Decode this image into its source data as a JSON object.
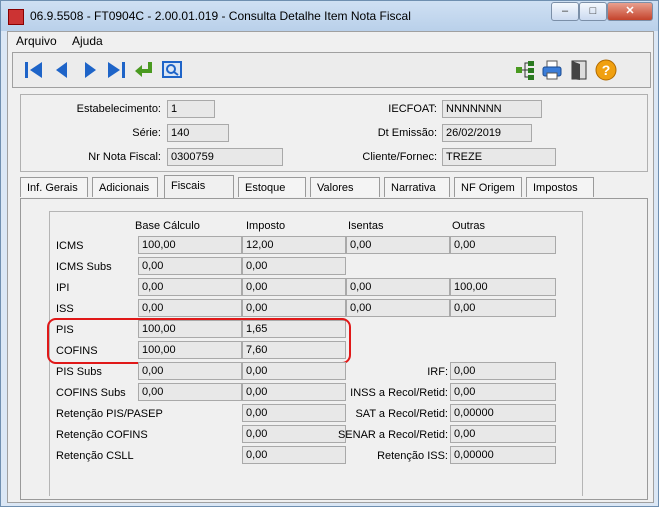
{
  "window": {
    "title": "06.9.5508 - FT0904C - 2.00.01.019 - Consulta Detalhe Item Nota Fiscal"
  },
  "menu": {
    "items": [
      "Arquivo",
      "Ajuda"
    ]
  },
  "header": {
    "estabelecimento": {
      "label": "Estabelecimento:",
      "value": "1"
    },
    "serie": {
      "label": "Série:",
      "value": "140"
    },
    "nr_nota": {
      "label": "Nr Nota Fiscal:",
      "value": "0300759"
    },
    "iecfoat": {
      "label": "IECFOAT:",
      "value": "NNNNNNN"
    },
    "dt_emissao": {
      "label": "Dt Emissão:",
      "value": "26/02/2019"
    },
    "cliente": {
      "label": "Cliente/Fornec:",
      "value": "TREZE"
    }
  },
  "tabs": [
    "Inf. Gerais",
    "Adicionais",
    "Fiscais",
    "Estoque",
    "Valores",
    "Narrativa",
    "NF Origem",
    "Impostos"
  ],
  "active_tab": "Fiscais",
  "fiscais": {
    "columns": [
      "Base Cálculo",
      "Imposto",
      "Isentas",
      "Outras"
    ],
    "rows": [
      {
        "label": "ICMS",
        "values": [
          "100,00",
          "12,00",
          "0,00",
          "0,00"
        ]
      },
      {
        "label": "ICMS Subs",
        "values": [
          "0,00",
          "0,00"
        ]
      },
      {
        "label": "IPI",
        "values": [
          "0,00",
          "0,00",
          "0,00",
          "100,00"
        ]
      },
      {
        "label": "ISS",
        "values": [
          "0,00",
          "0,00",
          "0,00",
          "0,00"
        ]
      },
      {
        "label": "PIS",
        "values": [
          "100,00",
          "1,65"
        ]
      },
      {
        "label": "COFINS",
        "values": [
          "100,00",
          "7,60"
        ]
      },
      {
        "label": "PIS Subs",
        "values": [
          "0,00",
          "0,00"
        ]
      },
      {
        "label": "COFINS Subs",
        "values": [
          "0,00",
          "0,00"
        ]
      },
      {
        "label": "Retenção PIS/PASEP",
        "values": [
          "0,00"
        ]
      },
      {
        "label": "Retenção COFINS",
        "values": [
          "0,00"
        ]
      },
      {
        "label": "Retenção CSLL",
        "values": [
          "0,00"
        ]
      }
    ],
    "right": [
      {
        "label": "IRF:",
        "value": "0,00"
      },
      {
        "label": "INSS a Recol/Retid:",
        "value": "0,00"
      },
      {
        "label": "SAT a Recol/Retid:",
        "value": "0,00000"
      },
      {
        "label": "SENAR a Recol/Retid:",
        "value": "0,00"
      },
      {
        "label": "Retenção ISS:",
        "value": "0,00000"
      }
    ]
  },
  "colors": {
    "highlight": "#e01818",
    "nav_blue": "#1e64c8",
    "accept_green": "#4a9a20",
    "help_orange": "#f0a010"
  }
}
